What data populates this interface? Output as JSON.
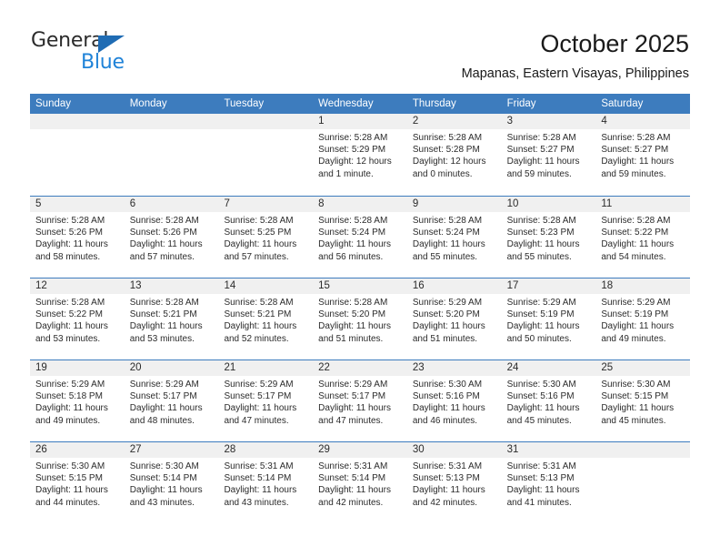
{
  "brand": {
    "word_one": "General",
    "word_two": "Blue",
    "triangle_color": "#1f6cb4",
    "blue_text_color": "#2083d8"
  },
  "header": {
    "title": "October 2025",
    "location": "Mapanas, Eastern Visayas, Philippines"
  },
  "theme": {
    "header_blue": "#3d7cbe",
    "daynum_gray": "#f0f0f0",
    "text": "#2b2b2b"
  },
  "weekdays": [
    "Sunday",
    "Monday",
    "Tuesday",
    "Wednesday",
    "Thursday",
    "Friday",
    "Saturday"
  ],
  "weeks": [
    [
      {
        "day": "",
        "sunrise": "",
        "sunset": "",
        "daylight": "",
        "empty": true
      },
      {
        "day": "",
        "sunrise": "",
        "sunset": "",
        "daylight": "",
        "empty": true
      },
      {
        "day": "",
        "sunrise": "",
        "sunset": "",
        "daylight": "",
        "empty": true
      },
      {
        "day": "1",
        "sunrise": "Sunrise: 5:28 AM",
        "sunset": "Sunset: 5:29 PM",
        "daylight": "Daylight: 12 hours and 1 minute."
      },
      {
        "day": "2",
        "sunrise": "Sunrise: 5:28 AM",
        "sunset": "Sunset: 5:28 PM",
        "daylight": "Daylight: 12 hours and 0 minutes."
      },
      {
        "day": "3",
        "sunrise": "Sunrise: 5:28 AM",
        "sunset": "Sunset: 5:27 PM",
        "daylight": "Daylight: 11 hours and 59 minutes."
      },
      {
        "day": "4",
        "sunrise": "Sunrise: 5:28 AM",
        "sunset": "Sunset: 5:27 PM",
        "daylight": "Daylight: 11 hours and 59 minutes."
      }
    ],
    [
      {
        "day": "5",
        "sunrise": "Sunrise: 5:28 AM",
        "sunset": "Sunset: 5:26 PM",
        "daylight": "Daylight: 11 hours and 58 minutes."
      },
      {
        "day": "6",
        "sunrise": "Sunrise: 5:28 AM",
        "sunset": "Sunset: 5:26 PM",
        "daylight": "Daylight: 11 hours and 57 minutes."
      },
      {
        "day": "7",
        "sunrise": "Sunrise: 5:28 AM",
        "sunset": "Sunset: 5:25 PM",
        "daylight": "Daylight: 11 hours and 57 minutes."
      },
      {
        "day": "8",
        "sunrise": "Sunrise: 5:28 AM",
        "sunset": "Sunset: 5:24 PM",
        "daylight": "Daylight: 11 hours and 56 minutes."
      },
      {
        "day": "9",
        "sunrise": "Sunrise: 5:28 AM",
        "sunset": "Sunset: 5:24 PM",
        "daylight": "Daylight: 11 hours and 55 minutes."
      },
      {
        "day": "10",
        "sunrise": "Sunrise: 5:28 AM",
        "sunset": "Sunset: 5:23 PM",
        "daylight": "Daylight: 11 hours and 55 minutes."
      },
      {
        "day": "11",
        "sunrise": "Sunrise: 5:28 AM",
        "sunset": "Sunset: 5:22 PM",
        "daylight": "Daylight: 11 hours and 54 minutes."
      }
    ],
    [
      {
        "day": "12",
        "sunrise": "Sunrise: 5:28 AM",
        "sunset": "Sunset: 5:22 PM",
        "daylight": "Daylight: 11 hours and 53 minutes."
      },
      {
        "day": "13",
        "sunrise": "Sunrise: 5:28 AM",
        "sunset": "Sunset: 5:21 PM",
        "daylight": "Daylight: 11 hours and 53 minutes."
      },
      {
        "day": "14",
        "sunrise": "Sunrise: 5:28 AM",
        "sunset": "Sunset: 5:21 PM",
        "daylight": "Daylight: 11 hours and 52 minutes."
      },
      {
        "day": "15",
        "sunrise": "Sunrise: 5:28 AM",
        "sunset": "Sunset: 5:20 PM",
        "daylight": "Daylight: 11 hours and 51 minutes."
      },
      {
        "day": "16",
        "sunrise": "Sunrise: 5:29 AM",
        "sunset": "Sunset: 5:20 PM",
        "daylight": "Daylight: 11 hours and 51 minutes."
      },
      {
        "day": "17",
        "sunrise": "Sunrise: 5:29 AM",
        "sunset": "Sunset: 5:19 PM",
        "daylight": "Daylight: 11 hours and 50 minutes."
      },
      {
        "day": "18",
        "sunrise": "Sunrise: 5:29 AM",
        "sunset": "Sunset: 5:19 PM",
        "daylight": "Daylight: 11 hours and 49 minutes."
      }
    ],
    [
      {
        "day": "19",
        "sunrise": "Sunrise: 5:29 AM",
        "sunset": "Sunset: 5:18 PM",
        "daylight": "Daylight: 11 hours and 49 minutes."
      },
      {
        "day": "20",
        "sunrise": "Sunrise: 5:29 AM",
        "sunset": "Sunset: 5:17 PM",
        "daylight": "Daylight: 11 hours and 48 minutes."
      },
      {
        "day": "21",
        "sunrise": "Sunrise: 5:29 AM",
        "sunset": "Sunset: 5:17 PM",
        "daylight": "Daylight: 11 hours and 47 minutes."
      },
      {
        "day": "22",
        "sunrise": "Sunrise: 5:29 AM",
        "sunset": "Sunset: 5:17 PM",
        "daylight": "Daylight: 11 hours and 47 minutes."
      },
      {
        "day": "23",
        "sunrise": "Sunrise: 5:30 AM",
        "sunset": "Sunset: 5:16 PM",
        "daylight": "Daylight: 11 hours and 46 minutes."
      },
      {
        "day": "24",
        "sunrise": "Sunrise: 5:30 AM",
        "sunset": "Sunset: 5:16 PM",
        "daylight": "Daylight: 11 hours and 45 minutes."
      },
      {
        "day": "25",
        "sunrise": "Sunrise: 5:30 AM",
        "sunset": "Sunset: 5:15 PM",
        "daylight": "Daylight: 11 hours and 45 minutes."
      }
    ],
    [
      {
        "day": "26",
        "sunrise": "Sunrise: 5:30 AM",
        "sunset": "Sunset: 5:15 PM",
        "daylight": "Daylight: 11 hours and 44 minutes."
      },
      {
        "day": "27",
        "sunrise": "Sunrise: 5:30 AM",
        "sunset": "Sunset: 5:14 PM",
        "daylight": "Daylight: 11 hours and 43 minutes."
      },
      {
        "day": "28",
        "sunrise": "Sunrise: 5:31 AM",
        "sunset": "Sunset: 5:14 PM",
        "daylight": "Daylight: 11 hours and 43 minutes."
      },
      {
        "day": "29",
        "sunrise": "Sunrise: 5:31 AM",
        "sunset": "Sunset: 5:14 PM",
        "daylight": "Daylight: 11 hours and 42 minutes."
      },
      {
        "day": "30",
        "sunrise": "Sunrise: 5:31 AM",
        "sunset": "Sunset: 5:13 PM",
        "daylight": "Daylight: 11 hours and 42 minutes."
      },
      {
        "day": "31",
        "sunrise": "Sunrise: 5:31 AM",
        "sunset": "Sunset: 5:13 PM",
        "daylight": "Daylight: 11 hours and 41 minutes."
      },
      {
        "day": "",
        "sunrise": "",
        "sunset": "",
        "daylight": "",
        "empty": true
      }
    ]
  ]
}
